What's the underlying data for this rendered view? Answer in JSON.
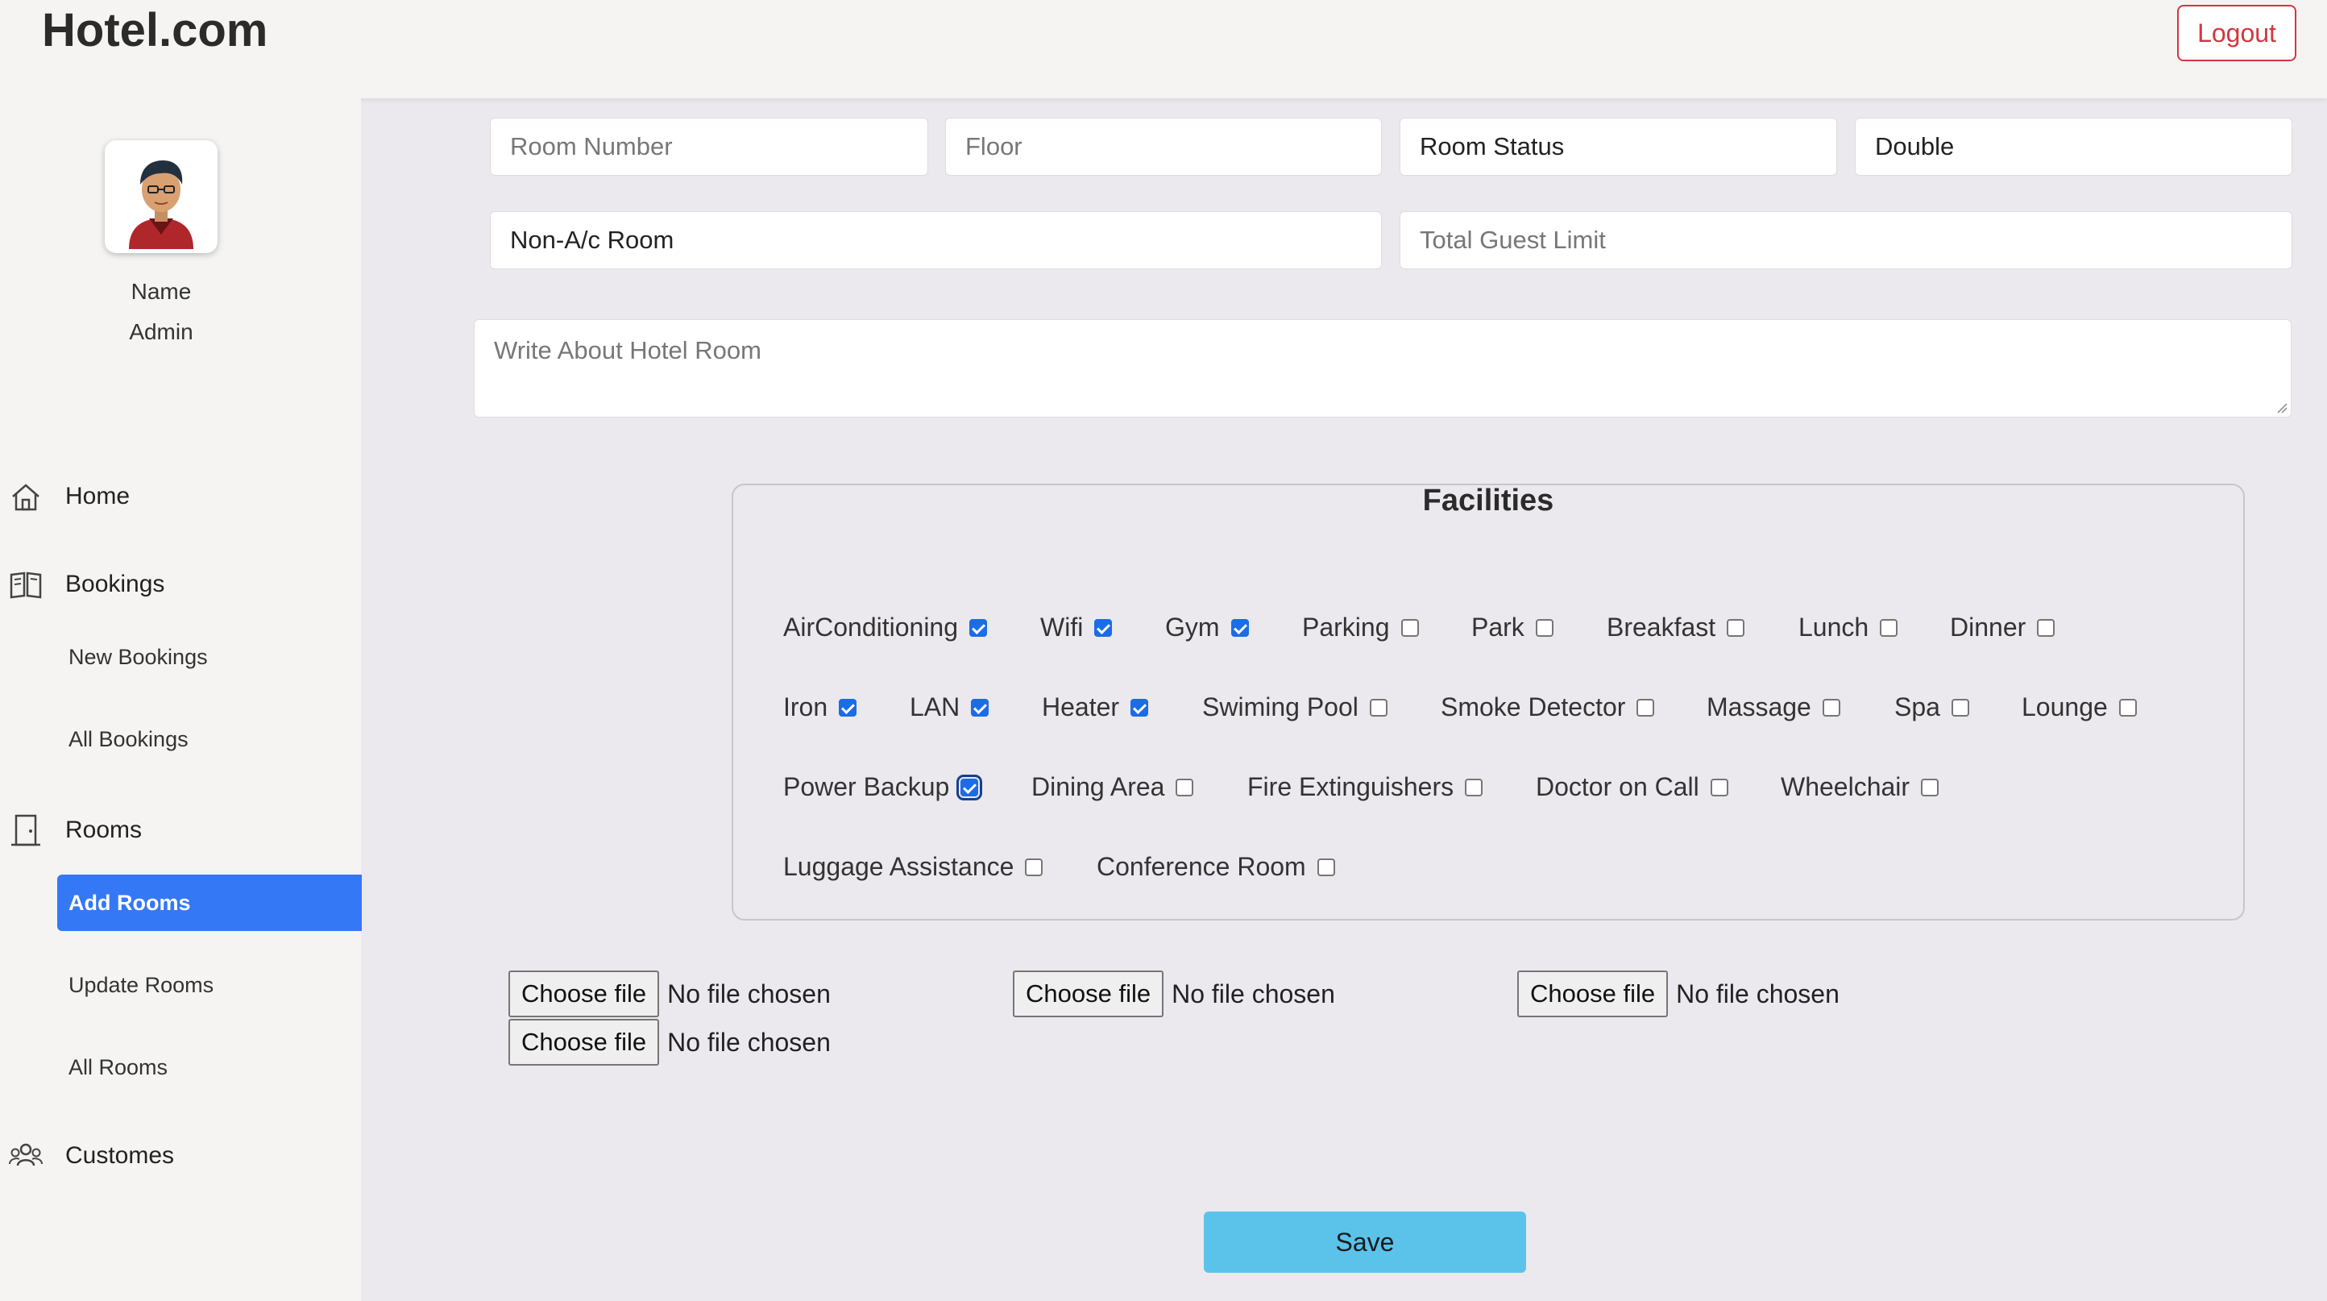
{
  "brand": "Hotel.com",
  "header": {
    "logout_label": "Logout"
  },
  "user": {
    "name": "Name",
    "role": "Admin"
  },
  "nav": {
    "home": "Home",
    "bookings": "Bookings",
    "new_bookings": "New Bookings",
    "all_bookings": "All Bookings",
    "rooms": "Rooms",
    "add_rooms": "Add Rooms",
    "update_rooms": "Update Rooms",
    "all_rooms": "All Rooms",
    "customers": "Customes"
  },
  "form": {
    "room_number_placeholder": "Room Number",
    "floor_placeholder": "Floor",
    "room_status": "Room Status",
    "room_type": "Double",
    "ac_type": "Non-A/c Room",
    "guest_limit_placeholder": "Total Guest Limit",
    "about_placeholder": "Write About Hotel Room"
  },
  "facilities": {
    "title": "Facilities",
    "items": [
      {
        "label": "AirConditioning",
        "checked": true
      },
      {
        "label": "Wifi",
        "checked": true
      },
      {
        "label": "Gym",
        "checked": true
      },
      {
        "label": "Parking",
        "checked": false
      },
      {
        "label": "Park",
        "checked": false
      },
      {
        "label": "Breakfast",
        "checked": false
      },
      {
        "label": "Lunch",
        "checked": false
      },
      {
        "label": "Dinner",
        "checked": false
      },
      {
        "label": "Iron",
        "checked": true
      },
      {
        "label": "LAN",
        "checked": true
      },
      {
        "label": "Heater",
        "checked": true
      },
      {
        "label": "Swiming Pool",
        "checked": false
      },
      {
        "label": "Smoke Detector",
        "checked": false
      },
      {
        "label": "Massage",
        "checked": false
      },
      {
        "label": "Spa",
        "checked": false
      },
      {
        "label": "Lounge",
        "checked": false
      },
      {
        "label": "Power Backup",
        "checked": true,
        "focused": true
      },
      {
        "label": "Dining Area",
        "checked": false
      },
      {
        "label": "Fire Extinguishers",
        "checked": false
      },
      {
        "label": "Doctor on Call",
        "checked": false
      },
      {
        "label": "Wheelchair",
        "checked": false
      },
      {
        "label": "Luggage Assistance",
        "checked": false
      },
      {
        "label": "Conference Room",
        "checked": false
      }
    ]
  },
  "files": [
    {
      "button": "Choose file",
      "status": "No file chosen"
    },
    {
      "button": "Choose file",
      "status": "No file chosen"
    },
    {
      "button": "Choose file",
      "status": "No file chosen"
    },
    {
      "button": "Choose file",
      "status": "No file chosen"
    }
  ],
  "save_label": "Save",
  "colors": {
    "accent": "#3478f6",
    "checkbox": "#1a6ce8",
    "logout": "#d2373f",
    "save": "#5bc3ea",
    "background": "#ebe9ed",
    "sidebar": "#f5f4f3"
  },
  "icons": {
    "home": "home-icon",
    "bookings": "book-icon",
    "rooms": "door-icon",
    "customers": "users-icon"
  }
}
